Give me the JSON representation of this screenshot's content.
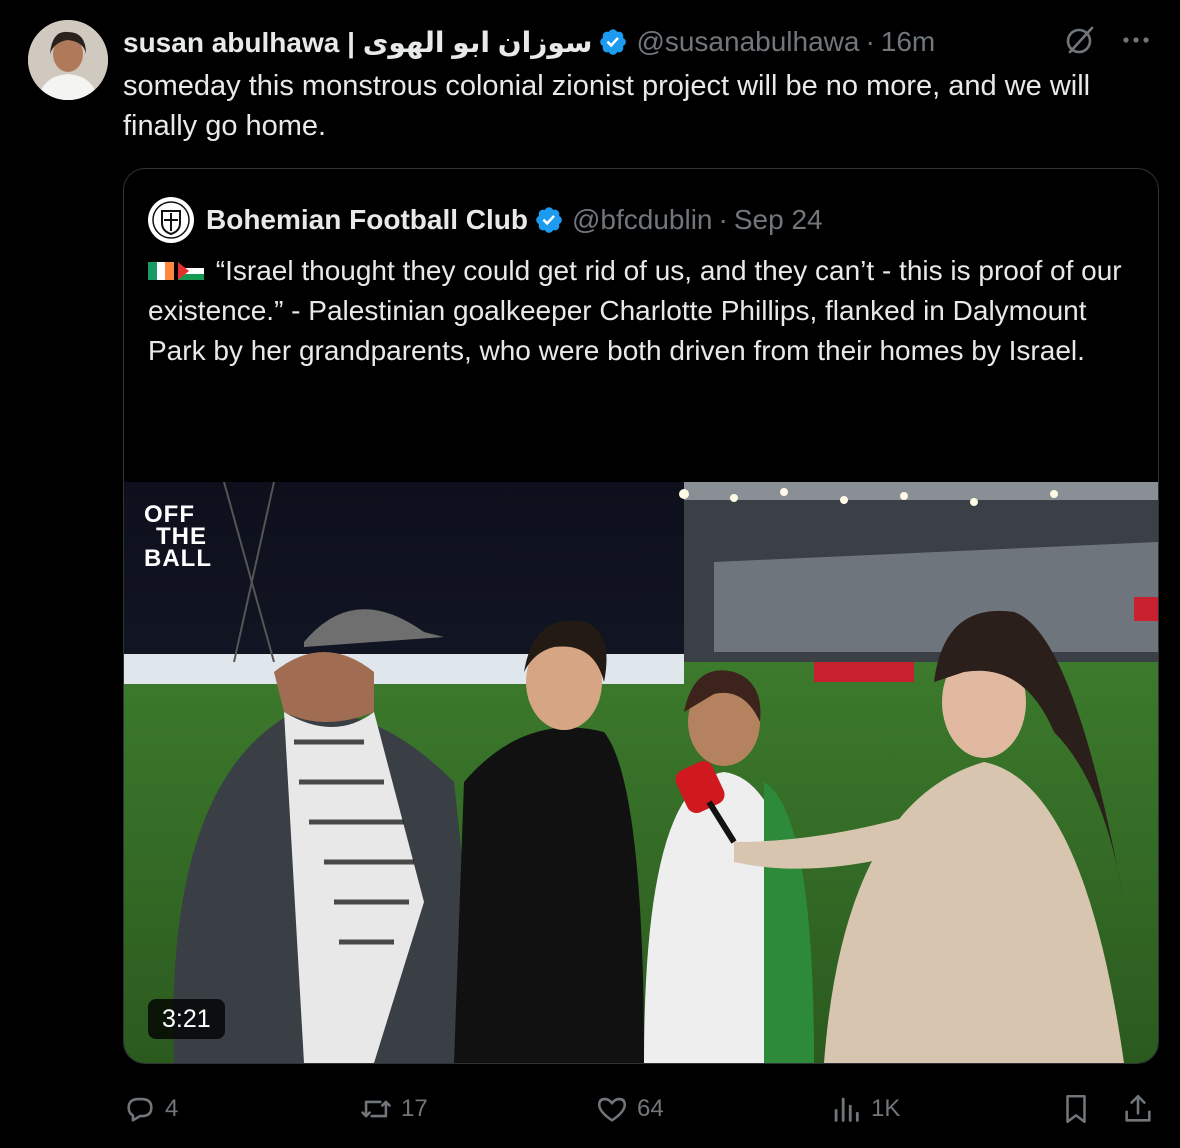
{
  "author": {
    "display_name": "susan abulhawa | سوزان ابو الهوى",
    "handle": "@susanabulhawa",
    "time": "16m"
  },
  "separator": "·",
  "post_text": "someday this monstrous colonial zionist project will be no more, and we will finally go home.",
  "quoted": {
    "display_name": "Bohemian Football Club",
    "handle": "@bfcdublin",
    "date": "Sep 24",
    "text": "“Israel thought they could get rid of us, and they can’t - this is proof of our existence.” - Palestinian goalkeeper Charlotte Phillips, flanked in Dalymount Park by her grandparents, who were both driven from their homes by Israel.",
    "ellipsis": "...",
    "media": {
      "duration": "3:21",
      "watermark": [
        "OFF",
        "THE",
        "BALL"
      ]
    }
  },
  "actions": {
    "replies": "4",
    "reposts": "17",
    "likes": "64",
    "views": "1K"
  },
  "icons": {
    "top_right": [
      "grok-icon",
      "more-icon"
    ],
    "actions": [
      "reply-icon",
      "repost-icon",
      "like-icon",
      "views-icon",
      "bookmark-icon",
      "share-icon"
    ]
  },
  "colors": {
    "background": "#000000",
    "primary_text": "#e7e9ea",
    "secondary_text": "#71767b",
    "border": "#2f3336",
    "verified": "#1d9bf0"
  }
}
